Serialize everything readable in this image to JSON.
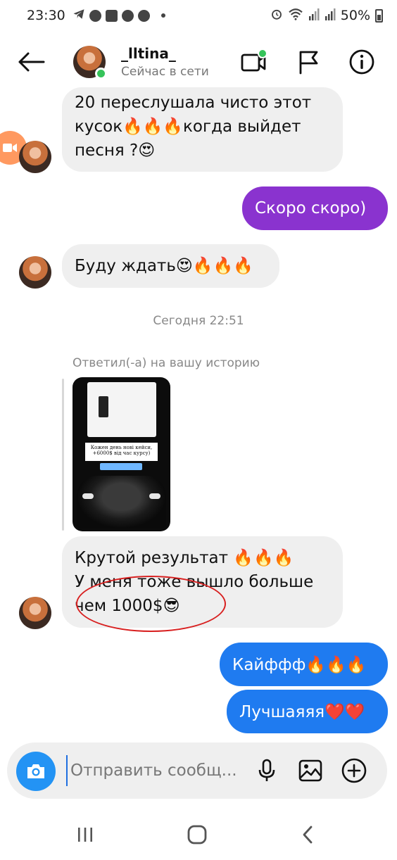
{
  "status_bar": {
    "time": "23:30",
    "battery": "50%"
  },
  "header": {
    "username": "_lltina_",
    "status": "Сейчас в сети"
  },
  "messages": [
    {
      "side": "in",
      "text_lines": [
        "20 переслушала чисто этот",
        "кусок🔥🔥🔥когда выйдет",
        "песня ?😍"
      ]
    },
    {
      "side": "out",
      "text": "Скоро скоро)",
      "color": "#8a33cf"
    },
    {
      "side": "in",
      "text": "Буду ждать😍🔥🔥🔥"
    },
    {
      "timestamp": "Сегодня 22:51"
    },
    {
      "reply_label": "Ответил(-а) на вашу историю"
    },
    {
      "side": "in",
      "text_lines": [
        "Крутой результат 🔥🔥🔥",
        "У меня тоже вышло больше",
        "чем 1000$😎"
      ]
    },
    {
      "side": "out",
      "text": "Кайффф🔥🔥🔥",
      "color": "#1f7bf0"
    },
    {
      "side": "out",
      "text": "Лучшаяяя❤️❤️",
      "color": "#1f7bf0"
    }
  ],
  "story": {
    "caption_lines": [
      "Кожен день нові кейси,",
      "+6000$ від час курсу)"
    ]
  },
  "composer": {
    "placeholder": "Отправить сообщ..."
  },
  "colors": {
    "accent_blue": "#2393f4",
    "online_green": "#36c35a",
    "annotation_red": "#d82020"
  },
  "icons": [
    "back-arrow-icon",
    "video-call-icon",
    "flag-icon",
    "info-icon",
    "camera-icon",
    "microphone-icon",
    "gallery-icon",
    "plus-circle-icon",
    "recents-icon",
    "home-icon",
    "back-icon"
  ]
}
